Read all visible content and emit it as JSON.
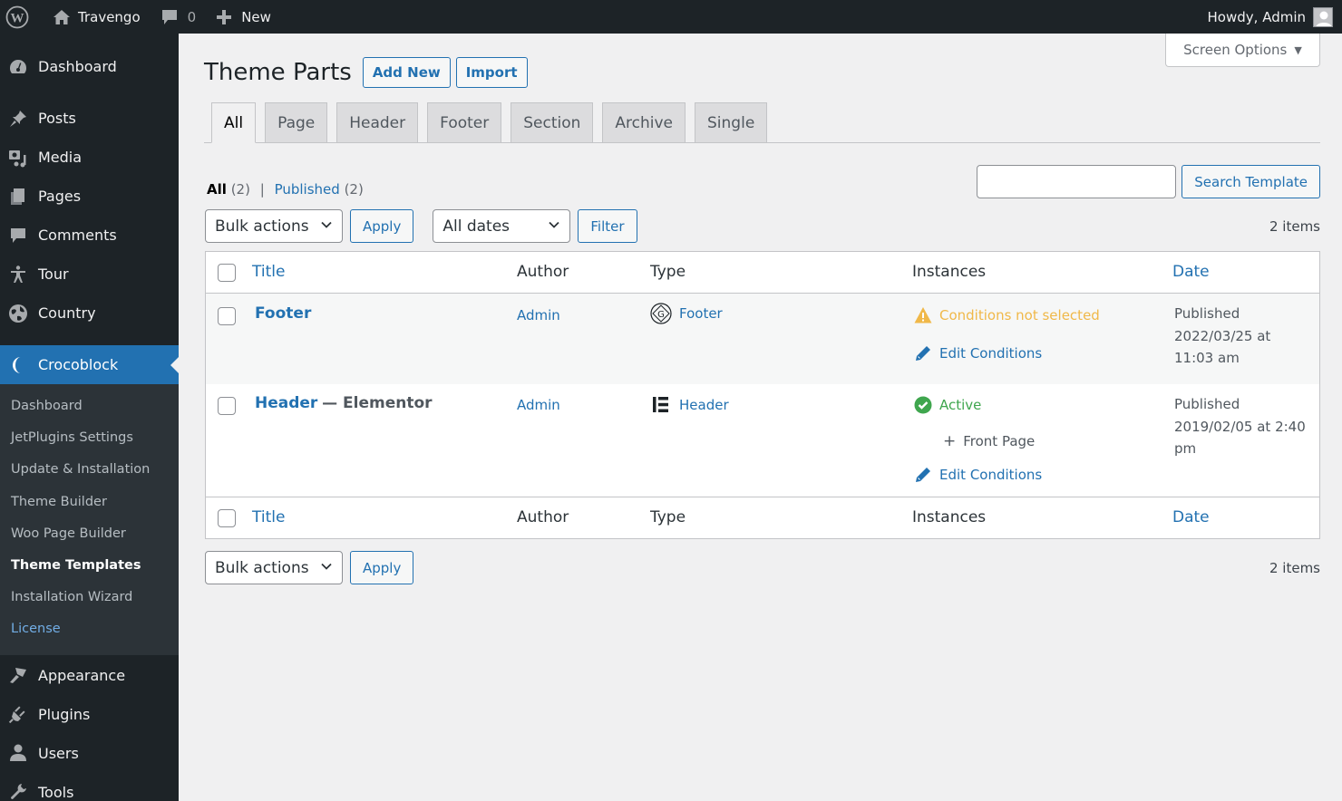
{
  "adminbar": {
    "site_name": "Travengo",
    "comments_count": "0",
    "new_label": "New",
    "howdy": "Howdy, Admin"
  },
  "sidebar": {
    "items_top": [
      {
        "label": "Dashboard",
        "icon": "dashboard-icon"
      },
      {
        "label": "Posts",
        "icon": "pin-icon"
      },
      {
        "label": "Media",
        "icon": "media-icon"
      },
      {
        "label": "Pages",
        "icon": "pages-icon"
      },
      {
        "label": "Comments",
        "icon": "comment-icon"
      },
      {
        "label": "Tour",
        "icon": "person-icon"
      },
      {
        "label": "Country",
        "icon": "globe-icon"
      }
    ],
    "current": {
      "label": "Crocoblock",
      "icon": "crocoblock-icon"
    },
    "submenu": [
      {
        "label": "Dashboard"
      },
      {
        "label": "JetPlugins Settings"
      },
      {
        "label": "Update & Installation"
      },
      {
        "label": "Theme Builder"
      },
      {
        "label": "Woo Page Builder"
      },
      {
        "label": "Theme Templates",
        "active": true
      },
      {
        "label": "Installation Wizard"
      },
      {
        "label": "License"
      }
    ],
    "items_bottom": [
      {
        "label": "Appearance",
        "icon": "brush-icon"
      },
      {
        "label": "Plugins",
        "icon": "plugin-icon"
      },
      {
        "label": "Users",
        "icon": "user-icon"
      },
      {
        "label": "Tools",
        "icon": "wrench-icon"
      }
    ]
  },
  "screen_options": {
    "label": "Screen Options"
  },
  "page": {
    "title": "Theme Parts",
    "add_new": "Add New",
    "import": "Import"
  },
  "tabs": [
    {
      "label": "All",
      "active": true
    },
    {
      "label": "Page"
    },
    {
      "label": "Header"
    },
    {
      "label": "Footer"
    },
    {
      "label": "Section"
    },
    {
      "label": "Archive"
    },
    {
      "label": "Single"
    }
  ],
  "views": {
    "all_label": "All",
    "all_count": "(2)",
    "separator": "|",
    "published_label": "Published",
    "published_count": "(2)"
  },
  "search": {
    "value": "",
    "placeholder": "",
    "button": "Search Template"
  },
  "tablenav_top": {
    "bulk_actions": "Bulk actions",
    "apply": "Apply",
    "dates": "All dates",
    "filter": "Filter",
    "items": "2 items"
  },
  "tablenav_bottom": {
    "bulk_actions": "Bulk actions",
    "apply": "Apply",
    "items": "2 items"
  },
  "table": {
    "columns": {
      "title": "Title",
      "author": "Author",
      "type": "Type",
      "instances": "Instances",
      "date": "Date"
    },
    "rows": [
      {
        "title": "Footer",
        "title_suffix": "",
        "author": "Admin",
        "type": "Footer",
        "type_icon": "gutenberg-icon",
        "status": "Conditions not selected",
        "status_kind": "warning",
        "conditions": [],
        "edit_conditions": "Edit Conditions",
        "date_status": "Published",
        "date_value": "2022/03/25 at 11:03 am"
      },
      {
        "title": "Header",
        "title_suffix": "— Elementor",
        "author": "Admin",
        "type": "Header",
        "type_icon": "elementor-icon",
        "status": "Active",
        "status_kind": "success",
        "conditions": [
          "Front Page"
        ],
        "edit_conditions": "Edit Conditions",
        "date_status": "Published",
        "date_value": "2019/02/05 at 2:40 pm"
      }
    ]
  },
  "colors": {
    "accent": "#2271b1",
    "adminbar_bg": "#1d2327",
    "warning": "#f0b849",
    "success": "#3fa64e"
  }
}
